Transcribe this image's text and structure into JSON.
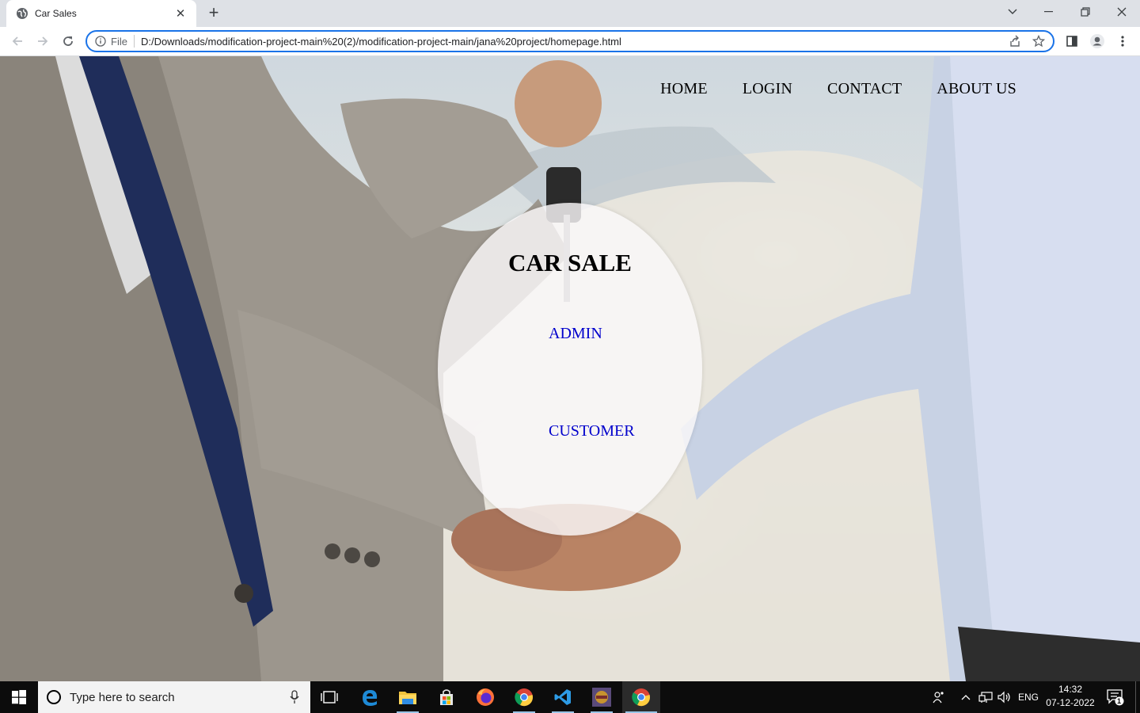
{
  "browser": {
    "tab_title": "Car Sales",
    "site_info_label": "File",
    "url": "D:/Downloads/modification-project-main%20(2)/modification-project-main/jana%20project/homepage.html"
  },
  "page": {
    "nav": [
      "HOME",
      "LOGIN",
      "CONTACT",
      "ABOUT US"
    ],
    "heading": "CAR SALE",
    "admin_link": "ADMIN",
    "customer_link": "CUSTOMER"
  },
  "taskbar": {
    "search_placeholder": "Type here to search",
    "language": "ENG",
    "time": "14:32",
    "date": "07-12-2022",
    "notification_count": "1"
  }
}
